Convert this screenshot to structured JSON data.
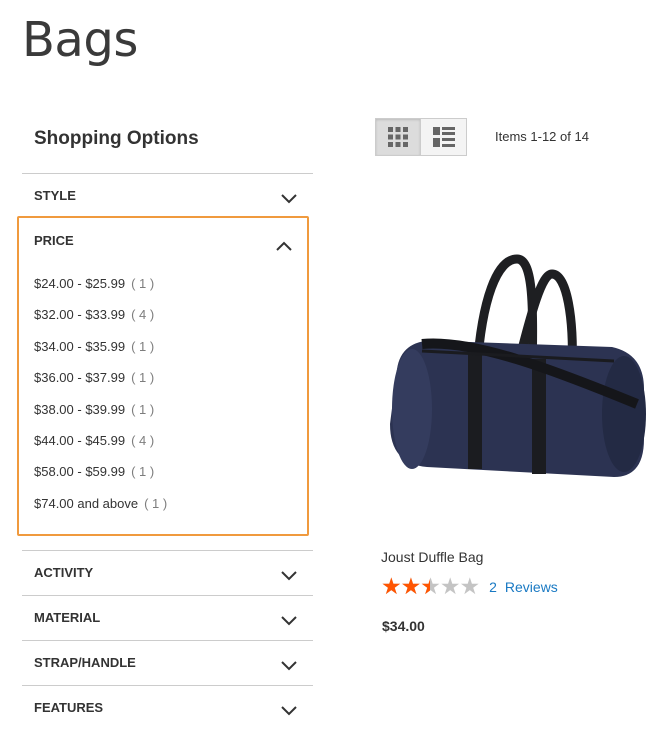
{
  "page": {
    "title": "Bags"
  },
  "sidebar": {
    "title": "Shopping Options",
    "filters": {
      "style": {
        "label": "STYLE",
        "expanded": false
      },
      "price": {
        "label": "PRICE",
        "expanded": true,
        "options": [
          {
            "range": "$24.00 - $25.99",
            "count": "( 1 )"
          },
          {
            "range": "$32.00 - $33.99",
            "count": "( 4 )"
          },
          {
            "range": "$34.00 - $35.99",
            "count": "( 1 )"
          },
          {
            "range": "$36.00 - $37.99",
            "count": "( 1 )"
          },
          {
            "range": "$38.00 - $39.99",
            "count": "( 1 )"
          },
          {
            "range": "$44.00 - $45.99",
            "count": "( 4 )"
          },
          {
            "range": "$58.00 - $59.99",
            "count": "( 1 )"
          },
          {
            "range": "$74.00 and above",
            "count": "( 1 )"
          }
        ]
      },
      "activity": {
        "label": "ACTIVITY",
        "expanded": false
      },
      "material": {
        "label": "MATERIAL",
        "expanded": false
      },
      "strap": {
        "label": "STRAP/HANDLE",
        "expanded": false
      },
      "features": {
        "label": "FEATURES",
        "expanded": false
      }
    }
  },
  "toolbar": {
    "grid_icon": "grid-icon",
    "list_icon": "list-icon",
    "active_mode": "grid",
    "items_count": "Items 1-12 of 14"
  },
  "product": {
    "name": "Joust Duffle Bag",
    "rating_fraction": 0.5,
    "review_count": "2",
    "reviews_label": "Reviews",
    "price": "$34.00",
    "image_icon": "duffle-bag-image"
  },
  "colors": {
    "highlight_border": "#f09a3e",
    "star_filled": "#ff5501",
    "star_empty": "#c4c4c4",
    "link": "#1979c3"
  }
}
